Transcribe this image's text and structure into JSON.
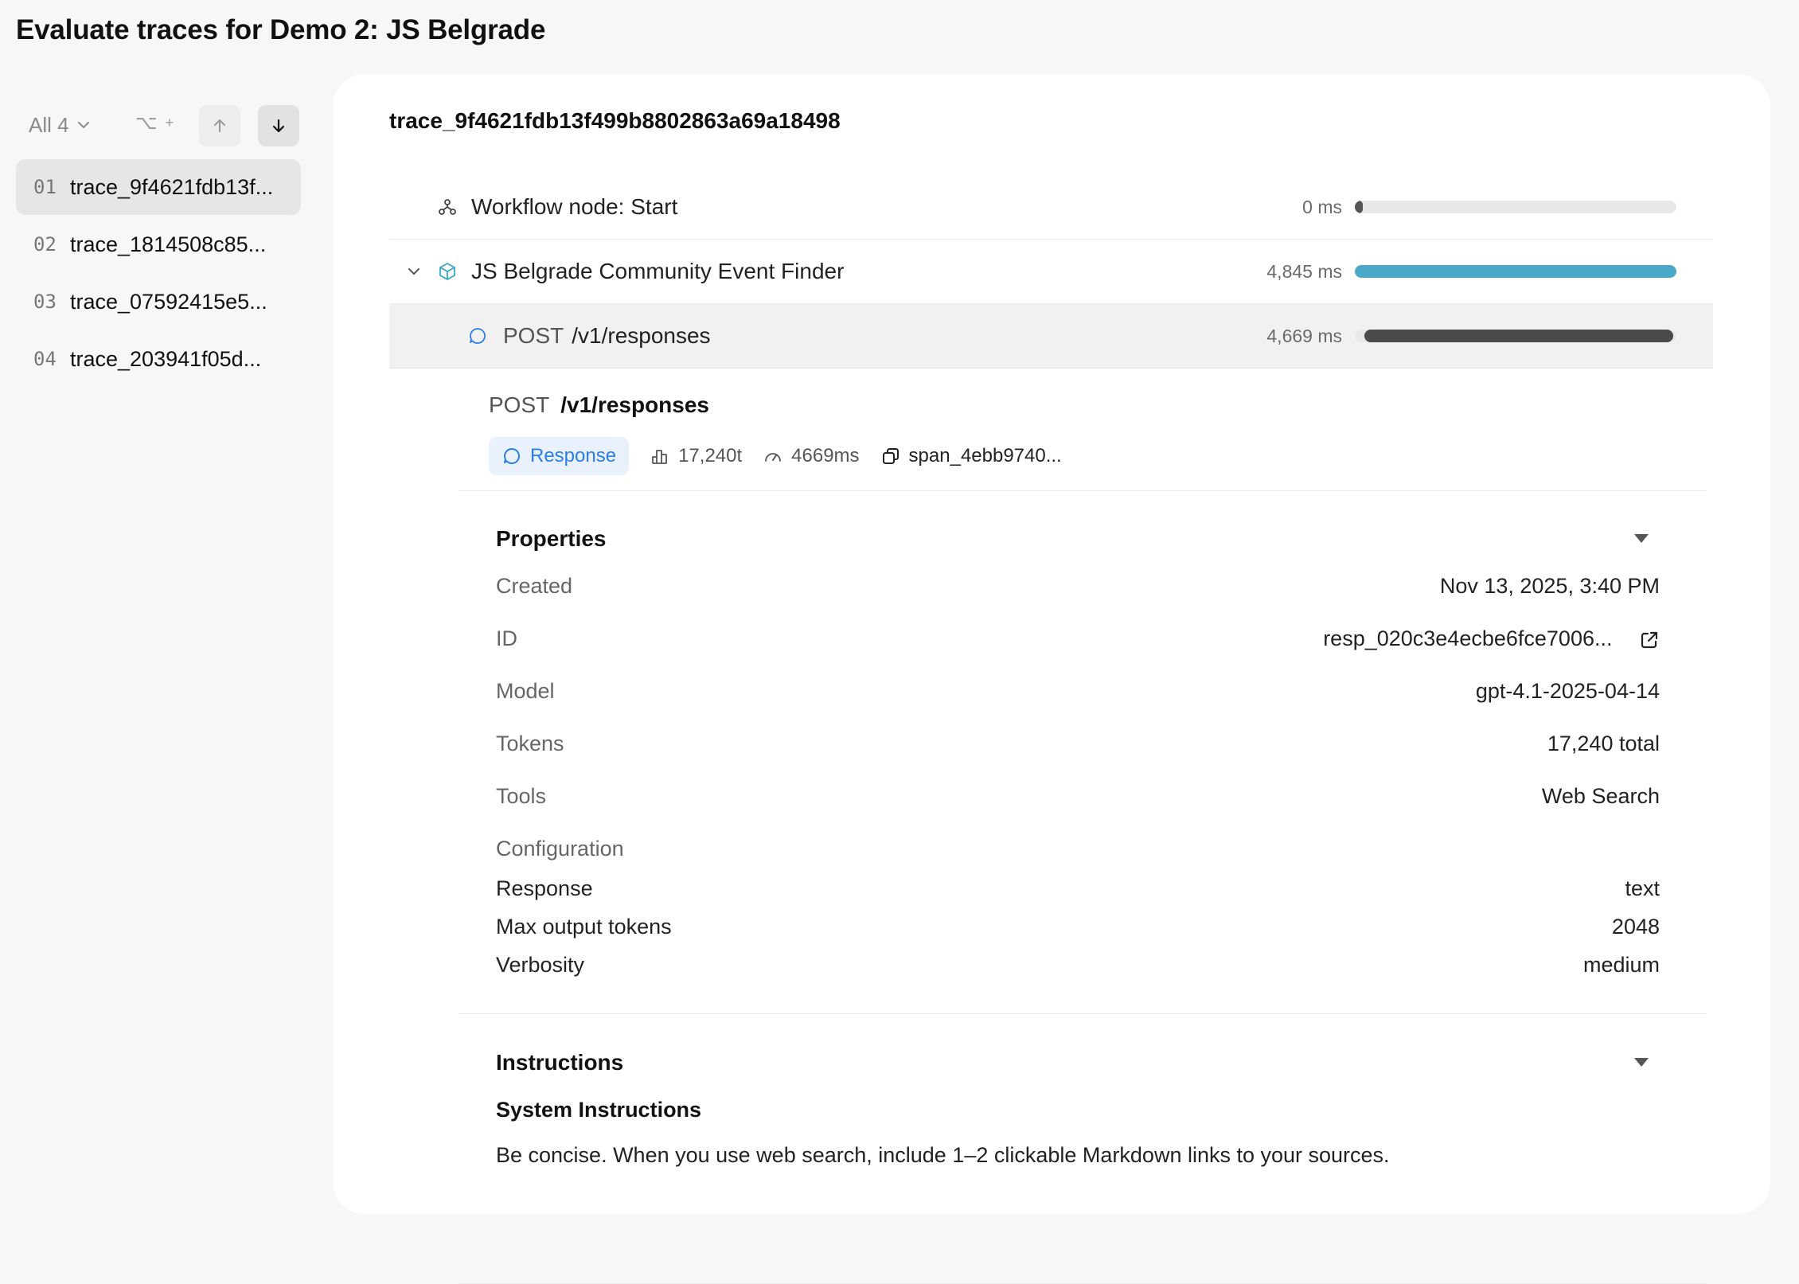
{
  "page": {
    "title": "Evaluate traces for Demo 2: JS Belgrade"
  },
  "sidebar": {
    "filter_label": "All 4",
    "kbd_hint": "⌥",
    "kbd_plus": "+",
    "traces": [
      {
        "num": "01",
        "name": "trace_9f4621fdb13f...",
        "active": true
      },
      {
        "num": "02",
        "name": "trace_1814508c85...",
        "active": false
      },
      {
        "num": "03",
        "name": "trace_07592415e5...",
        "active": false
      },
      {
        "num": "04",
        "name": "trace_203941f05d...",
        "active": false
      }
    ]
  },
  "trace": {
    "title": "trace_9f4621fdb13f499b8802863a69a18498",
    "spans": [
      {
        "label": "Workflow node: Start",
        "duration": "0 ms",
        "bar_start": 0.0,
        "bar_fraction": 0.01,
        "bar_color": "#555555"
      },
      {
        "label": "JS Belgrade Community Event Finder",
        "duration": "4,845 ms",
        "bar_start": 0.0,
        "bar_fraction": 1.0,
        "bar_color": "#4aa8c8"
      },
      {
        "method": "POST",
        "label": "/v1/responses",
        "duration": "4,669 ms",
        "bar_start": 0.03,
        "bar_fraction": 0.96,
        "bar_color": "#4a4a4a"
      }
    ]
  },
  "detail": {
    "method": "POST",
    "path": "/v1/responses",
    "chip_label": "Response",
    "tokens": "17,240t",
    "latency": "4669ms",
    "span_id": "span_4ebb9740...",
    "properties": {
      "heading": "Properties",
      "created_label": "Created",
      "created_value": "Nov 13, 2025, 3:40 PM",
      "id_label": "ID",
      "id_value": "resp_020c3e4ecbe6fce7006...",
      "model_label": "Model",
      "model_value": "gpt-4.1-2025-04-14",
      "tokens_label": "Tokens",
      "tokens_value": "17,240 total",
      "tools_label": "Tools",
      "tools_value": "Web Search",
      "config_label": "Configuration",
      "response_label": "Response",
      "response_value": "text",
      "max_tokens_label": "Max output tokens",
      "max_tokens_value": "2048",
      "verbosity_label": "Verbosity",
      "verbosity_value": "medium"
    },
    "instructions": {
      "heading": "Instructions",
      "system_title": "System Instructions",
      "system_text": "Be concise. When you use web search, include 1–2 clickable Markdown links to your sources."
    }
  },
  "colors": {
    "accent_blue": "#2b7de9",
    "bar_teal": "#4aa8c8",
    "bar_dark": "#4a4a4a"
  }
}
